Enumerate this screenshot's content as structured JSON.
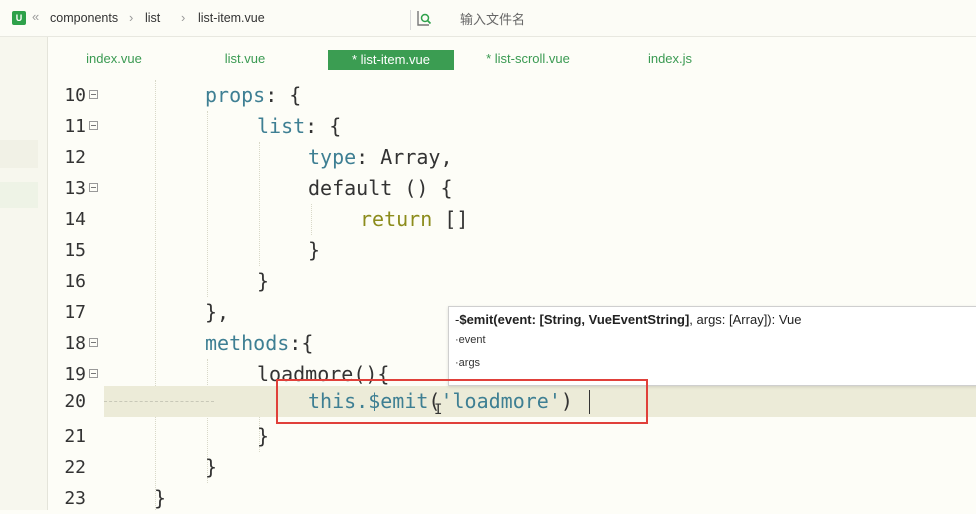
{
  "breadcrumb": {
    "logo": "U",
    "parts": [
      "components",
      "list",
      "list-item.vue"
    ]
  },
  "search": {
    "placeholder": "输入文件名"
  },
  "tabs": [
    {
      "label": "index.vue",
      "active": false
    },
    {
      "label": "list.vue",
      "active": false
    },
    {
      "label": "* list-item.vue",
      "active": true
    },
    {
      "label": "* list-scroll.vue",
      "active": false
    },
    {
      "label": "index.js",
      "active": false
    }
  ],
  "code": {
    "current_line": 20,
    "lines": [
      {
        "num": "10",
        "fold": true
      },
      {
        "num": "11",
        "fold": true
      },
      {
        "num": "12",
        "fold": false
      },
      {
        "num": "13",
        "fold": true
      },
      {
        "num": "14",
        "fold": false
      },
      {
        "num": "15",
        "fold": false
      },
      {
        "num": "16",
        "fold": false
      },
      {
        "num": "17",
        "fold": false
      },
      {
        "num": "18",
        "fold": true
      },
      {
        "num": "19",
        "fold": true
      },
      {
        "num": "20",
        "fold": false
      },
      {
        "num": "21",
        "fold": false
      },
      {
        "num": "22",
        "fold": false
      },
      {
        "num": "23",
        "fold": false
      }
    ],
    "tokens": {
      "props": "props",
      "colon_brace": ": {",
      "list": "list",
      "type": "type",
      "type_rest": ": Array,",
      "default": "default () {",
      "return": "return",
      "arr": " []",
      "close": "}",
      "close_comma": "},",
      "methods": "methods",
      "methods_rest": ":{",
      "loadmore": "loadmore(){",
      "this": "this",
      "emit": ".$emit",
      "open_paren": "(",
      "str": "'loadmore'",
      "close_paren": ")"
    }
  },
  "hint": {
    "signature_prefix": "-",
    "signature_bold": "$emit(event: [String, VueEventString]",
    "signature_rest": ", args: [Array]): Vue",
    "params": [
      "·event",
      "·args"
    ]
  }
}
